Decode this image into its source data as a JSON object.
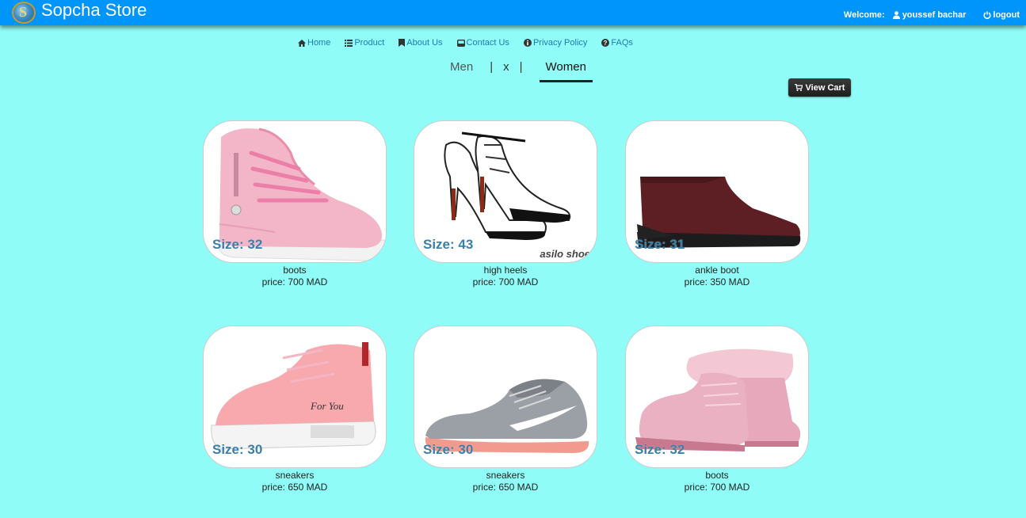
{
  "header": {
    "brand": "Sopcha Store",
    "welcome_label": "Welcome:",
    "user_name": "youssef bachar",
    "logout_label": "logout",
    "bg_color": "#0095fa"
  },
  "nav": {
    "items": [
      {
        "label": "Home",
        "icon": "home-icon"
      },
      {
        "label": "Product",
        "icon": "list-icon"
      },
      {
        "label": "About Us",
        "icon": "bookmark-icon"
      },
      {
        "label": "Contact Us",
        "icon": "inbox-icon"
      },
      {
        "label": "Privacy Policy",
        "icon": "info-icon"
      },
      {
        "label": "FAQs",
        "icon": "question-icon"
      }
    ]
  },
  "tabs": {
    "men": "Men",
    "sep": "|",
    "x": "x",
    "women": "Women",
    "active": "Women"
  },
  "cart": {
    "label": "View Cart",
    "icon": "cart-icon"
  },
  "products": [
    {
      "size": "Size: 32",
      "name": "boots",
      "price": "price: 700 MAD",
      "shoe": "pink-boot"
    },
    {
      "size": "Size: 43",
      "name": "high heels",
      "price": "price: 700 MAD",
      "shoe": "high-heel",
      "watermark": "asilo shoe"
    },
    {
      "size": "Size: 31",
      "name": "ankle boot",
      "price": "price: 350 MAD",
      "shoe": "ankle-boot"
    },
    {
      "size": "Size: 30",
      "name": "sneakers",
      "price": "price: 650 MAD",
      "shoe": "pink-sneaker"
    },
    {
      "size": "Size: 30",
      "name": "sneakers",
      "price": "price: 650 MAD",
      "shoe": "grey-running-shoe"
    },
    {
      "size": "Size: 32",
      "name": "boots",
      "price": "price: 700 MAD",
      "shoe": "fur-boot"
    }
  ],
  "colors": {
    "page_bg": "#8ffcf7",
    "link": "#1f78b4",
    "size_text": "#3a7fa8"
  }
}
